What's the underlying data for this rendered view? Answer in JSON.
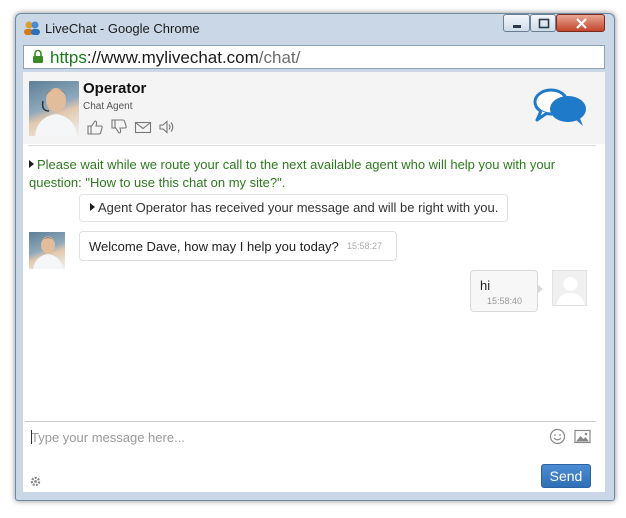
{
  "window": {
    "title": "LiveChat - Google Chrome",
    "controls": {
      "minimize": "minimize-icon",
      "maximize": "maximize-icon",
      "close": "close-icon"
    }
  },
  "address_bar": {
    "scheme": "https",
    "host": "://www.mylivechat.com",
    "path": "/chat/"
  },
  "header": {
    "agent_name": "Operator",
    "agent_title": "Chat Agent",
    "icons": [
      "thumbs-up-icon",
      "thumbs-down-icon",
      "email-icon",
      "sound-icon"
    ],
    "logo": "chat-bubbles-logo"
  },
  "messages": {
    "system_1": "Please wait while we route your call to the next available agent who will help you with your question: \"How to use this chat on my site?\".",
    "system_2": "Agent Operator has received your message and will be right with you.",
    "operator_msg": {
      "text": "Welcome Dave, how may I help you today?",
      "time": "15:58:27"
    },
    "user_msg": {
      "text": "hi",
      "time": "15:58:40"
    }
  },
  "composer": {
    "placeholder": "Type your message here...",
    "send_label": "Send"
  },
  "colors": {
    "system_text": "#2d7a1e",
    "send_button": "#3a7cc4",
    "logo": "#1f7ac9"
  }
}
